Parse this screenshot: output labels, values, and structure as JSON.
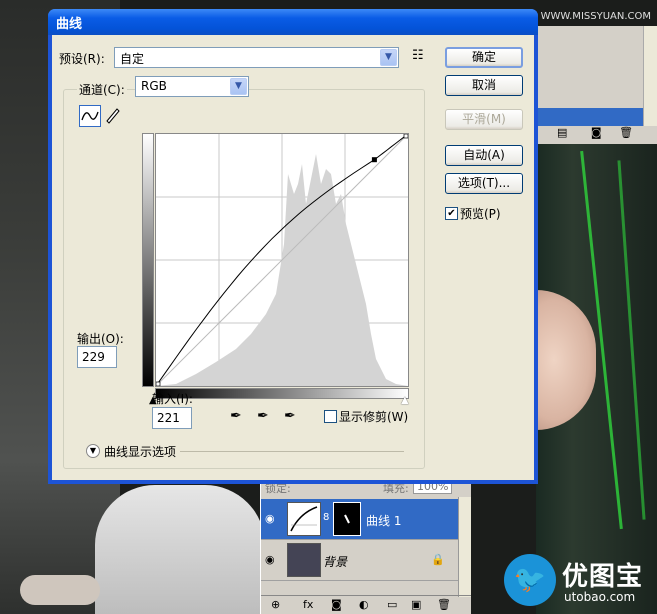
{
  "watermark": "思缘设计论坛 WWW.MISSYUAN.COM",
  "dialog": {
    "title": "曲线",
    "preset_label": "预设(R):",
    "preset_value": "自定",
    "channel_label": "通道(C):",
    "channel_value": "RGB",
    "output_label": "输出(O):",
    "output_value": "229",
    "input_label": "输入(I):",
    "input_value": "221",
    "show_clipping_label": "显示修剪(W)",
    "curve_display_options_label": "曲线显示选项",
    "buttons": {
      "ok": "确定",
      "cancel": "取消",
      "smooth": "平滑(M)",
      "auto": "自动(A)",
      "options": "选项(T)..."
    },
    "preview_label": "预览(P)",
    "preview_checked": true,
    "show_clipping_checked": false
  },
  "layers": {
    "lock_label": "锁定:",
    "fill_label": "填充:",
    "fill_value": "100%",
    "items": [
      {
        "name": "曲线 1",
        "selected": true
      },
      {
        "name": "背景",
        "selected": false
      }
    ]
  },
  "logo": {
    "cn": "优图宝",
    "en": "utobao.com"
  },
  "curve": {
    "points": [
      [
        0,
        0
      ],
      [
        221,
        229
      ],
      [
        255,
        255
      ]
    ]
  }
}
